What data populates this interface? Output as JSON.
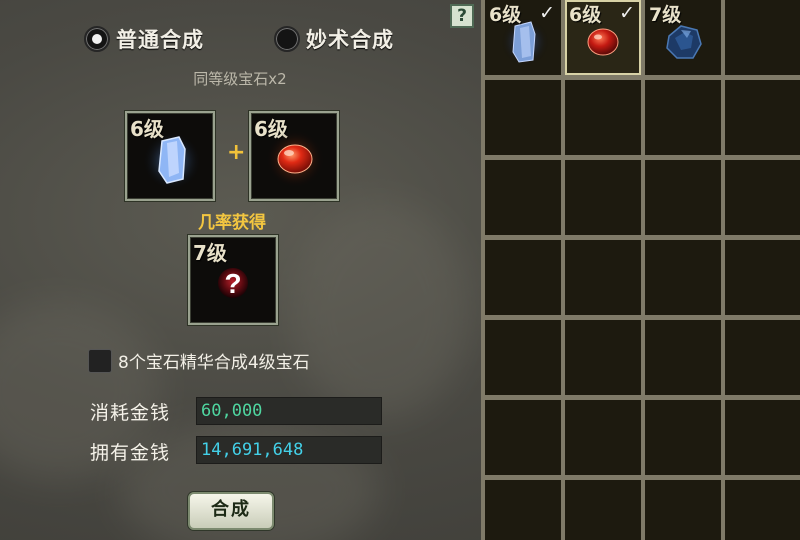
{
  "synthesis_modes": [
    {
      "label": "普通合成",
      "selected": true
    },
    {
      "label": "妙术合成",
      "selected": false
    }
  ],
  "requirement_text": "同等级宝石x2",
  "inputs": [
    {
      "level": "6级",
      "gem": "blue-crystal"
    },
    {
      "level": "6级",
      "gem": "red-gem"
    }
  ],
  "plus_sign": "+",
  "chance_text": "几率获得",
  "result": {
    "level": "7级",
    "gem": "unknown"
  },
  "essence_option": {
    "label": "8个宝石精华合成4级宝石",
    "checked": false
  },
  "money": {
    "cost_label": "消耗金钱",
    "cost_value": "60,000",
    "cost_color": "#4fd6a0",
    "own_label": "拥有金钱",
    "own_value": "14,691,648",
    "own_color": "#43d0e8"
  },
  "synthesize_button": "合成",
  "help_button": "?",
  "inventory": {
    "slots": [
      {
        "level": "6级",
        "checked": true,
        "gem": "blue-crystal"
      },
      {
        "level": "6级",
        "checked": true,
        "gem": "red-gem",
        "selected": true
      },
      {
        "level": "7级",
        "checked": false,
        "gem": "dark-blue-gem"
      }
    ],
    "check_mark": "✓"
  }
}
